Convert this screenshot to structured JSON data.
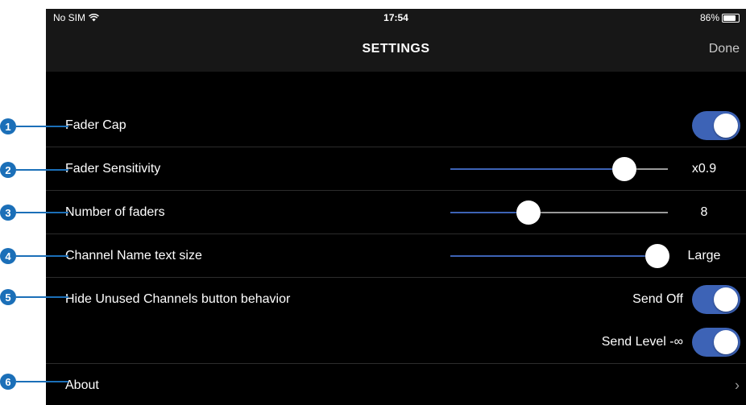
{
  "status": {
    "carrier": "No SIM",
    "time": "17:54",
    "battery": "86%",
    "battery_level": 0.86
  },
  "nav": {
    "title": "SETTINGS",
    "done": "Done"
  },
  "rows": {
    "fader_cap": {
      "label": "Fader Cap",
      "on": true
    },
    "fader_sensitivity": {
      "label": "Fader Sensitivity",
      "value": "x0.9",
      "position": 0.8
    },
    "number_of_faders": {
      "label": "Number of faders",
      "value": "8",
      "position": 0.36
    },
    "channel_name_text_size": {
      "label": "Channel Name text size",
      "value": "Large",
      "position": 0.95
    },
    "hide_unused": {
      "label": "Hide Unused Channels button behavior",
      "send_off": {
        "label": "Send Off",
        "on": true
      },
      "send_level": {
        "label": "Send Level -∞",
        "on": true
      }
    },
    "about": {
      "label": "About",
      "chevron": "›"
    }
  },
  "callouts": [
    "1",
    "2",
    "3",
    "4",
    "5",
    "6"
  ],
  "colors": {
    "accent": "#3d63b6",
    "callout": "#1b6fb8",
    "background": "#000000",
    "bar": "#171717"
  }
}
